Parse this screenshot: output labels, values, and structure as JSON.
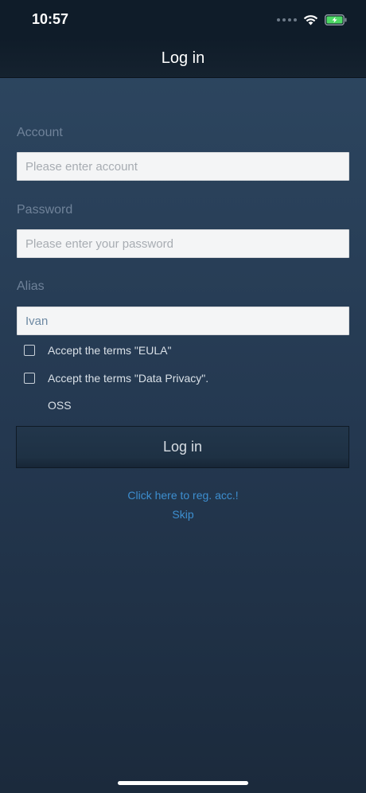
{
  "status_bar": {
    "time": "10:57",
    "icons": [
      "signal-dots-icon",
      "wifi-icon",
      "battery-charging-icon"
    ],
    "battery_color": "#4cd964"
  },
  "nav": {
    "title": "Log in"
  },
  "form": {
    "account": {
      "label": "Account",
      "placeholder": "Please enter account",
      "value": ""
    },
    "password": {
      "label": "Password",
      "placeholder": "Please enter your password",
      "value": ""
    },
    "alias": {
      "label": "Alias",
      "placeholder": "",
      "value": "Ivan"
    },
    "terms": [
      {
        "label": "Accept the terms \"EULA\"",
        "checked": false
      },
      {
        "label": "Accept the terms \"Data Privacy\".",
        "checked": false
      }
    ],
    "oss_label": "OSS",
    "login_button": "Log in"
  },
  "links": {
    "register": "Click here to reg. acc.!",
    "skip": "Skip"
  },
  "colors": {
    "background_top": "#2e4862",
    "background_bottom": "#1b2a3c",
    "nav_bar": "#0f1c29",
    "link": "#3d8fd0"
  }
}
